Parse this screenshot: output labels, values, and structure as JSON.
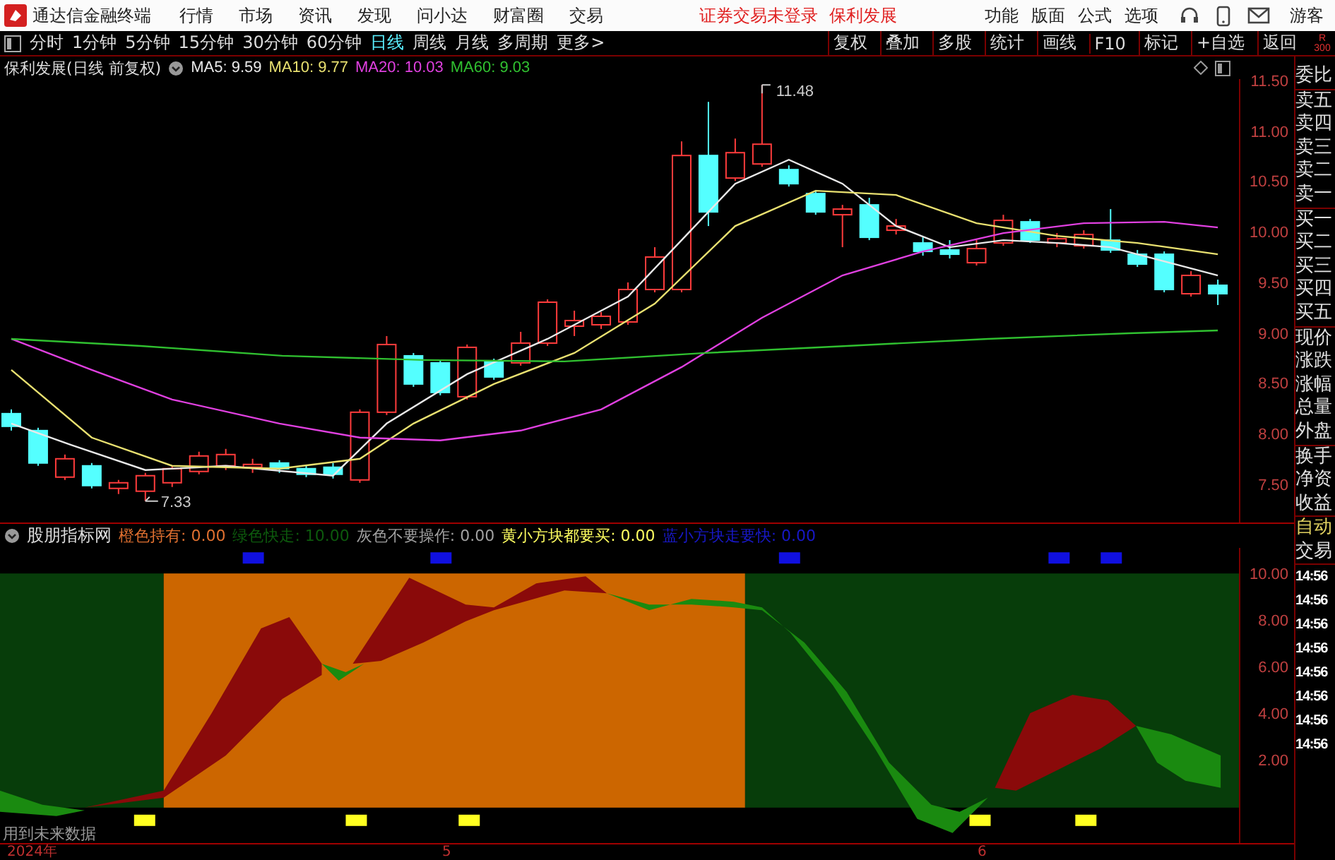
{
  "app_bar": {
    "title": "通达信金融终端",
    "menu": [
      "行情",
      "市场",
      "资讯",
      "发现",
      "问小达",
      "财富圈",
      "交易"
    ],
    "notices": [
      "证券交易未登录",
      "保利发展"
    ],
    "actions": [
      "功能",
      "版面",
      "公式",
      "选项"
    ],
    "user": "游客"
  },
  "toolbar": {
    "tabs": [
      {
        "label": "分时",
        "selected": false
      },
      {
        "label": "1分钟",
        "selected": false
      },
      {
        "label": "5分钟",
        "selected": false
      },
      {
        "label": "15分钟",
        "selected": false
      },
      {
        "label": "30分钟",
        "selected": false
      },
      {
        "label": "60分钟",
        "selected": false
      },
      {
        "label": "日线",
        "selected": true
      },
      {
        "label": "周线",
        "selected": false
      },
      {
        "label": "月线",
        "selected": false
      },
      {
        "label": "多周期",
        "selected": false
      },
      {
        "label": "更多>",
        "selected": false
      }
    ],
    "buttons": [
      "复权",
      "叠加",
      "多股",
      "统计",
      "画线",
      "F10",
      "标记",
      "+自选",
      "返回"
    ],
    "corner": [
      "R",
      "300"
    ]
  },
  "price_chart": {
    "title": "保利发展(日线 前复权)",
    "ma": [
      {
        "text": "MA5: 9.59",
        "color": "#e8e8e8"
      },
      {
        "text": "MA10: 9.77",
        "color": "#e8e070"
      },
      {
        "text": "MA20: 10.03",
        "color": "#e040e0"
      },
      {
        "text": "MA60: 9.03",
        "color": "#30c030"
      }
    ],
    "axis": [
      "11.50",
      "11.00",
      "10.50",
      "10.00",
      "9.50",
      "9.00",
      "8.50",
      "8.00",
      "7.50"
    ],
    "high_label": "11.48",
    "low_label": "7.33"
  },
  "indicator": {
    "title": "股朋指标网",
    "legend": [
      {
        "text": "橙色持有: 0.00",
        "color": "#e07030"
      },
      {
        "text": "绿色快走: 10.00",
        "color": "#0d5a0d"
      },
      {
        "text": "灰色不要操作: 0.00",
        "color": "#a0a0a0"
      },
      {
        "text": "黄小方块都要买: 0.00",
        "color": "#ffff60"
      },
      {
        "text": "蓝小方块走要快: 0.00",
        "color": "#1818c8"
      }
    ],
    "axis": [
      "10.00",
      "8.00",
      "6.00",
      "4.00",
      "2.00"
    ],
    "note": "用到未来数据"
  },
  "time_axis": [
    "2024年",
    "5",
    "6"
  ],
  "side_panel": {
    "groups": [
      [
        "委比"
      ],
      [
        "卖五",
        "卖四",
        "卖三",
        "卖二",
        "卖一"
      ],
      [
        "买一",
        "买二",
        "买三",
        "买四",
        "买五"
      ],
      [
        "现价",
        "涨跌",
        "涨幅",
        "总量",
        "外盘"
      ],
      [
        "换手",
        "净资",
        "收益"
      ],
      [
        {
          "text": "自动",
          "kind": "mode"
        },
        {
          "text": "交易",
          "kind": "label"
        }
      ]
    ],
    "times": [
      "14:56",
      "14:56",
      "14:56",
      "14:56",
      "14:56",
      "14:56",
      "14:56",
      "14:56"
    ]
  }
}
